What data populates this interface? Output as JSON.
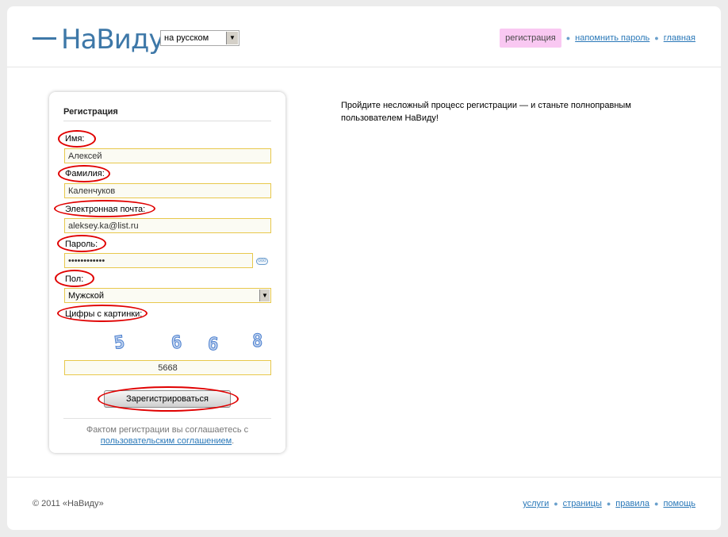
{
  "header": {
    "logo_text": "НаВиду",
    "language": "на русском",
    "nav": {
      "register": "регистрация",
      "remind_password": "напомнить пароль",
      "home": "главная"
    }
  },
  "form": {
    "title": "Регистрация",
    "first_name_label": "Имя:",
    "first_name_value": "Алексей",
    "last_name_label": "Фамилия:",
    "last_name_value": "Каленчуков",
    "email_label": "Электронная почта:",
    "email_value": "aleksey.ka@list.ru",
    "password_label": "Пароль:",
    "password_value": "••••••••••••",
    "gender_label": "Пол:",
    "gender_value": "Мужской",
    "captcha_label": "Цифры с картинки:",
    "captcha_digits": [
      "5",
      "6",
      "6",
      "8"
    ],
    "captcha_value": "5668",
    "submit_label": "Зарегистрироваться",
    "agreement_text": "Фактом регистрации вы соглашаетесь с",
    "agreement_link": "пользовательским соглашением",
    "agreement_end": "."
  },
  "intro_text": "Пройдите несложный процесс регистрации — и станьте полноправным пользователем НаВиду!",
  "footer": {
    "copyright": "© 2011 «НаВиду»",
    "nav": {
      "services": "услуги",
      "pages": "страницы",
      "rules": "правила",
      "help": "помощь"
    }
  },
  "colors": {
    "accent_link": "#2a78b8",
    "logo": "#3e78a8",
    "active_nav_bg": "#f9c8f2",
    "input_border": "#e8c84c",
    "highlight_oval": "#e00000"
  }
}
